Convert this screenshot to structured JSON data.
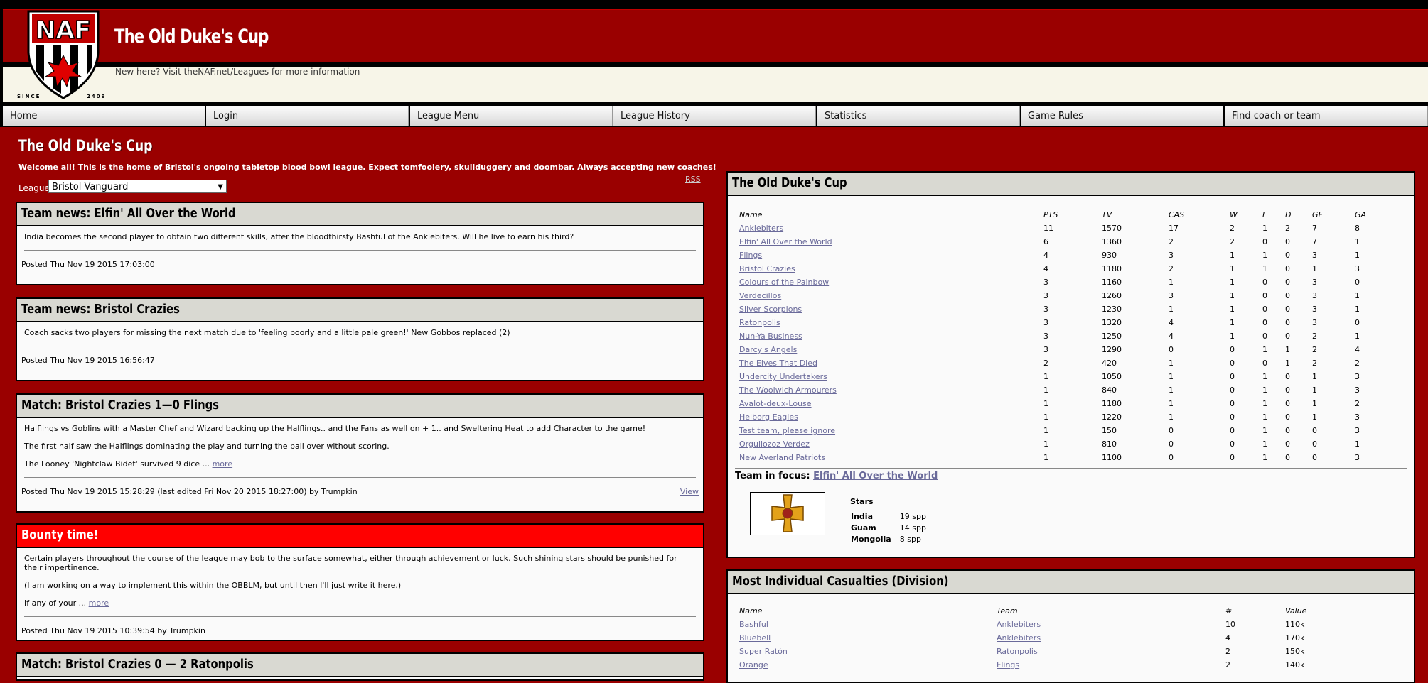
{
  "header": {
    "logo_alt": "NAF",
    "logo_text_left": "SINCE",
    "logo_text_right": "2409",
    "site_title": "The Old Duke's Cup",
    "tagline": "New here? Visit theNAF.net/Leagues for more information"
  },
  "nav": [
    "Home",
    "Login",
    "League Menu",
    "League History",
    "Statistics",
    "Game Rules",
    "Find coach or team"
  ],
  "main": {
    "title": "The Old Duke's Cup",
    "welcome": "Welcome all! This is the home of Bristol's ongoing tabletop blood bowl league. Expect tomfoolery, skullduggery and doombar. Always accepting new coaches!",
    "league_label": "League",
    "league_value": "Bristol Vanguard",
    "rss": "RSS"
  },
  "news": [
    {
      "title": "Team news: Elfin' All Over the World",
      "paras": [
        "India becomes the second player to obtain two different skills, after the bloodthirsty Bashful of the Anklebiters. Will he live to earn his third?"
      ],
      "more": "",
      "posted": "Posted Thu Nov 19 2015 17:03:00",
      "view": ""
    },
    {
      "title": "Team news: Bristol Crazies",
      "paras": [
        "Coach sacks two players for missing the next match due to 'feeling poorly and a little pale green!' New Gobbos replaced (2)"
      ],
      "more": "",
      "posted": "Posted Thu Nov 19 2015 16:56:47",
      "view": ""
    },
    {
      "title": "Match: Bristol Crazies 1—0 Flings",
      "paras": [
        "Halflings vs Goblins with a Master Chef and Wizard backing up the Halflings.. and the Fans as well on + 1.. and Sweltering Heat to add Character to the game!",
        "The first half saw the Halflings dominating the play and turning the ball over without scoring.",
        "The Looney 'Nightclaw Bidet' survived 9 dice ..."
      ],
      "more": "more",
      "posted": "Posted Thu Nov 19 2015 15:28:29 (last edited Fri Nov 20 2015 18:27:00) by Trumpkin",
      "view": "View"
    },
    {
      "title": "Bounty time!",
      "paras": [
        "Certain players throughout the course of the league may bob to the surface somewhat, either through achievement or luck. Such shining stars should be punished for their impertinence.",
        "(I am working on a way to implement this within the OBBLM, but until then I'll just write it here.)",
        "If any of your ..."
      ],
      "more": "more",
      "posted": "Posted Thu Nov 19 2015 10:39:54 by Trumpkin",
      "view": ""
    },
    {
      "title": "Match: Bristol Crazies 0 — 2 Ratonpolis",
      "paras": [],
      "more": "",
      "posted": "",
      "view": ""
    }
  ],
  "standings": {
    "title": "The Old Duke's Cup",
    "headers": [
      "Name",
      "PTS",
      "TV",
      "CAS",
      "W",
      "L",
      "D",
      "GF",
      "GA"
    ],
    "rows": [
      [
        "Anklebiters",
        "11",
        "1570",
        "17",
        "2",
        "1",
        "2",
        "7",
        "8"
      ],
      [
        "Elfin' All Over the World",
        "6",
        "1360",
        "2",
        "2",
        "0",
        "0",
        "7",
        "1"
      ],
      [
        "Flings",
        "4",
        "930",
        "3",
        "1",
        "1",
        "0",
        "3",
        "1"
      ],
      [
        "Bristol Crazies",
        "4",
        "1180",
        "2",
        "1",
        "1",
        "0",
        "1",
        "3"
      ],
      [
        "Colours of the Painbow",
        "3",
        "1160",
        "1",
        "1",
        "0",
        "0",
        "3",
        "0"
      ],
      [
        "Verdecillos",
        "3",
        "1260",
        "3",
        "1",
        "0",
        "0",
        "3",
        "1"
      ],
      [
        "Silver Scorpions",
        "3",
        "1230",
        "1",
        "1",
        "0",
        "0",
        "3",
        "1"
      ],
      [
        "Ratonpolis",
        "3",
        "1320",
        "4",
        "1",
        "0",
        "0",
        "3",
        "0"
      ],
      [
        "Nun-Ya Business",
        "3",
        "1250",
        "4",
        "1",
        "0",
        "0",
        "2",
        "1"
      ],
      [
        "Darcy's Angels",
        "3",
        "1290",
        "0",
        "0",
        "1",
        "1",
        "2",
        "4"
      ],
      [
        "The Elves That Died",
        "2",
        "420",
        "1",
        "0",
        "0",
        "1",
        "2",
        "2"
      ],
      [
        "Undercity Undertakers",
        "1",
        "1050",
        "1",
        "0",
        "1",
        "0",
        "1",
        "3"
      ],
      [
        "The Woolwich Armourers",
        "1",
        "840",
        "1",
        "0",
        "1",
        "0",
        "1",
        "3"
      ],
      [
        "Avalot-deux-Louse",
        "1",
        "1180",
        "1",
        "0",
        "1",
        "0",
        "1",
        "2"
      ],
      [
        "Helborg Eagles",
        "1",
        "1220",
        "1",
        "0",
        "1",
        "0",
        "1",
        "3"
      ],
      [
        "Test team, please ignore",
        "1",
        "150",
        "0",
        "0",
        "1",
        "0",
        "0",
        "3"
      ],
      [
        "Orgullozoz Verdez",
        "1",
        "810",
        "0",
        "0",
        "1",
        "0",
        "0",
        "1"
      ],
      [
        "New Averland Patriots",
        "1",
        "1100",
        "0",
        "0",
        "1",
        "0",
        "0",
        "3"
      ]
    ],
    "focus_label": "Team in focus:",
    "focus_team": "Elfin' All Over the World",
    "stars_label": "Stars",
    "stars": [
      [
        "India",
        "19 spp"
      ],
      [
        "Guam",
        "14 spp"
      ],
      [
        "Mongolia",
        "8 spp"
      ]
    ]
  },
  "casualties": {
    "title": "Most Individual Casualties (Division)",
    "headers": [
      "Name",
      "Team",
      "#",
      "Value"
    ],
    "rows": [
      [
        "Bashful",
        "Anklebiters",
        "10",
        "110k"
      ],
      [
        "Bluebell",
        "Anklebiters",
        "4",
        "170k"
      ],
      [
        "Super Ratón",
        "Ratonpolis",
        "2",
        "150k"
      ],
      [
        "Orange",
        "Flings",
        "2",
        "140k"
      ]
    ]
  }
}
